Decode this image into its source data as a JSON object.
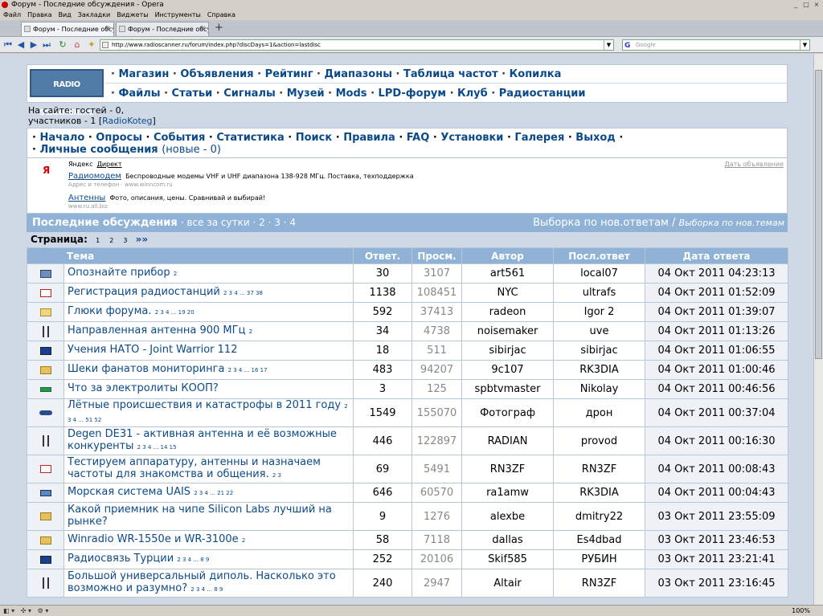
{
  "browser": {
    "title": "Форум - Последние обсуждения - Opera",
    "menu": [
      "Файл",
      "Правка",
      "Вид",
      "Закладки",
      "Виджеты",
      "Инструменты",
      "Справка"
    ],
    "tabs": [
      "Форум - Последние обсу...",
      "Форум - Последние обсу..."
    ],
    "url": "http://www.radioscanner.ru/forum/index.php?discDays=1&action=lastdisc",
    "search_placeholder": "Google",
    "zoom": "100%"
  },
  "site": {
    "logo_text": "RADIO SCANNER.RU",
    "nav_top": [
      "Магазин",
      "Объявления",
      "Рейтинг",
      "Диапазоны",
      "Таблица частот",
      "Копилка"
    ],
    "nav_bottom": [
      "Файлы",
      "Статьи",
      "Сигналы",
      "Музей",
      "Mods",
      "LPD-форум",
      "Клуб",
      "Радиостанции"
    ],
    "online_line1": "На сайте: гостей - 0,",
    "online_line2": "участников - 1 [",
    "online_user": "RadioKoteg",
    "online_close": "]",
    "forum_nav": [
      "Начало",
      "Опросы",
      "События",
      "Статистика",
      "Поиск",
      "Правила",
      "FAQ",
      "Установки",
      "Галерея",
      "Выход"
    ],
    "pm_label": "Личные сообщения",
    "pm_new": "(новые - 0)"
  },
  "ads": {
    "yandex_mark": "Я",
    "yandex": "Яндекс",
    "direct": "Директ",
    "give_ad": "Дать объявление",
    "items": [
      {
        "title": "Радиомодем",
        "text": "Беспроводные модемы VHF и UHF диапазона 138-928 МГц. Поставка, техподдержка",
        "sub": "Адрес и телефон · www.winncom.ru"
      },
      {
        "title": "Антенны",
        "text": "Фото, описания, цены. Сравнивай и выбирай!",
        "sub": "www.ru.all.biz"
      }
    ]
  },
  "section": {
    "title": "Последние обсуждения",
    "dot": "·",
    "filter_day": "все за сутки",
    "filter_pages": [
      "2",
      "3",
      "4"
    ],
    "right_plain": "Выборка по нов.ответам",
    "right_slash": "/",
    "right_link": "Выборка по нов.темам",
    "pages_label": "Страница:",
    "pages": [
      "1",
      "2",
      "3"
    ],
    "next": "»»"
  },
  "table": {
    "headers": [
      "Тема",
      "Ответ.",
      "Просм.",
      "Автор",
      "Посл.ответ",
      "Дата ответа"
    ],
    "rows": [
      {
        "icon": "monitor",
        "topic": "Опознайте прибор",
        "pages": "2",
        "replies": "30",
        "views": "3107",
        "author": "art561",
        "last": "local07",
        "date": "04 Окт 2011 04:23:13"
      },
      {
        "icon": "doc",
        "topic": "Регистрация радиостанций",
        "pages": "2 3 4 ... 37 38",
        "replies": "1138",
        "views": "108451",
        "author": "NYC",
        "last": "ultrafs",
        "date": "04 Окт 2011 01:52:09"
      },
      {
        "icon": "note",
        "topic": "Глюки форума.",
        "pages": "2 3 4 ... 19 20",
        "replies": "592",
        "views": "37413",
        "author": "radeon",
        "last": "Igor 2",
        "date": "04 Окт 2011 01:39:07"
      },
      {
        "icon": "antenna",
        "topic": "Направленная антенна 900 МГц",
        "pages": "2",
        "replies": "34",
        "views": "4738",
        "author": "noisemaker",
        "last": "uve",
        "date": "04 Окт 2011 01:13:26"
      },
      {
        "icon": "flag",
        "topic": "Учения НАТО - Joint Warrior 112",
        "pages": "",
        "replies": "18",
        "views": "511",
        "author": "sibirjac",
        "last": "sibirjac",
        "date": "04 Окт 2011 01:06:55"
      },
      {
        "icon": "folder",
        "topic": "Шеки фанатов мониторинга",
        "pages": "2 3 4 ... 16 17",
        "replies": "483",
        "views": "94207",
        "author": "9c107",
        "last": "RK3DIA",
        "date": "04 Окт 2011 01:00:46"
      },
      {
        "icon": "battery",
        "topic": "Что за электролиты КООП?",
        "pages": "",
        "replies": "3",
        "views": "125",
        "author": "spbtvmaster",
        "last": "Nikolay",
        "date": "04 Окт 2011 00:46:56"
      },
      {
        "icon": "plane",
        "topic": "Лётные происшествия и катастрофы в 2011 году",
        "pages": "2 3 4 ... 51 52",
        "replies": "1549",
        "views": "155070",
        "author": "Фотограф",
        "last": "дрон",
        "date": "04 Окт 2011 00:37:04"
      },
      {
        "icon": "antenna",
        "topic": "Degen DE31 - активная антенна и её возможные конкуренты",
        "pages": "2 3 4 ... 14 15",
        "replies": "446",
        "views": "122897",
        "author": "RADIAN",
        "last": "provod",
        "date": "04 Окт 2011 00:16:30"
      },
      {
        "icon": "doc",
        "topic": "Тестируем аппаратуру, антенны и назначаем частоты для знакомства и общения.",
        "pages": "2 3",
        "replies": "69",
        "views": "5491",
        "author": "RN3ZF",
        "last": "RN3ZF",
        "date": "04 Окт 2011 00:08:43"
      },
      {
        "icon": "ship",
        "topic": "Морская система UAIS",
        "pages": "2 3 4 ... 21 22",
        "replies": "646",
        "views": "60570",
        "author": "ra1amw",
        "last": "RK3DIA",
        "date": "04 Окт 2011 00:04:43"
      },
      {
        "icon": "folder",
        "topic": "Какой приемник на чипе Silicon Labs лучший на рынке?",
        "pages": "",
        "replies": "9",
        "views": "1276",
        "author": "alexbe",
        "last": "dmitry22",
        "date": "03 Окт 2011 23:55:09"
      },
      {
        "icon": "folder",
        "topic": "Winradio WR-1550e и WR-3100e",
        "pages": "2",
        "replies": "58",
        "views": "7118",
        "author": "dallas",
        "last": "Es4dbad",
        "date": "03 Окт 2011 23:46:53"
      },
      {
        "icon": "flag",
        "topic": "Радиосвязь Турции",
        "pages": "2 3 4 ... 8 9",
        "replies": "252",
        "views": "20106",
        "author": "Skif585",
        "last": "РУБИН",
        "date": "03 Окт 2011 23:21:41"
      },
      {
        "icon": "antenna",
        "topic": "Большой универсальный диполь. Насколько это возможно и разумно?",
        "pages": "2 3 4 ... 8 9",
        "replies": "240",
        "views": "2947",
        "author": "Altair",
        "last": "RN3ZF",
        "date": "03 Окт 2011 23:16:45"
      }
    ]
  }
}
